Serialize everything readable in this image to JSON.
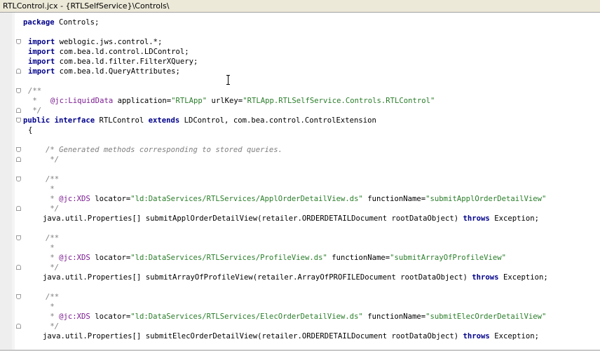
{
  "window": {
    "file_name": "RTLControl.jcx",
    "separator": " - ",
    "project_path": "{RTLSelfService}\\Controls\\"
  },
  "code": {
    "package_kw": "package",
    "package_name": " Controls;",
    "imports": [
      {
        "kw": "import",
        "name": " weblogic.jws.control.*;"
      },
      {
        "kw": "import",
        "name": " com.bea.ld.control.LDControl;"
      },
      {
        "kw": "import",
        "name": " com.bea.ld.filter.FilterXQuery;"
      },
      {
        "kw": "import",
        "name": " com.bea.ld.QueryAttributes;"
      }
    ],
    "doc_open": "/**",
    "doc_star": " *",
    "doc_close": " */",
    "ann_liquiddata": "@jc:LiquidData",
    "ann_app_attr": " application=",
    "ann_app_val": "\"RTLApp\"",
    "ann_url_attr": " urlKey=",
    "ann_url_val": "\"RTLApp.RTLSelfService.Controls.RTLControl\"",
    "public_kw": "public",
    "interface_kw": "interface",
    "interface_name": " RTLControl ",
    "extends_kw": "extends",
    "extends_list": " LDControl, com.bea.control.ControlExtension",
    "open_brace": "{",
    "generated_comment_1": "/* Generated methods corresponding to stored queries.",
    "generated_comment_2": " */",
    "xds_ann": "@jc:XDS",
    "locator_attr": " locator=",
    "function_attr": " functionName=",
    "throws_kw": "throws",
    "exception": " Exception;",
    "methods": [
      {
        "locator": "\"ld:DataServices/RTLServices/ApplOrderDetailView.ds\"",
        "function": "\"submitApplOrderDetailView\"",
        "signature": "java.util.Properties[] submitApplOrderDetailView(retailer.ORDERDETAILDocument rootDataObject) "
      },
      {
        "locator": "\"ld:DataServices/RTLServices/ProfileView.ds\"",
        "function": "\"submitArrayOfProfileView\"",
        "signature": "java.util.Properties[] submitArrayOfProfileView(retailer.ArrayOfPROFILEDocument rootDataObject) "
      },
      {
        "locator": "\"ld:DataServices/RTLServices/ElecOrderDetailView.ds\"",
        "function": "\"submitElecOrderDetailView\"",
        "signature": "java.util.Properties[] submitElecOrderDetailView(retailer.ORDERDETAILDocument rootDataObject) "
      }
    ]
  }
}
